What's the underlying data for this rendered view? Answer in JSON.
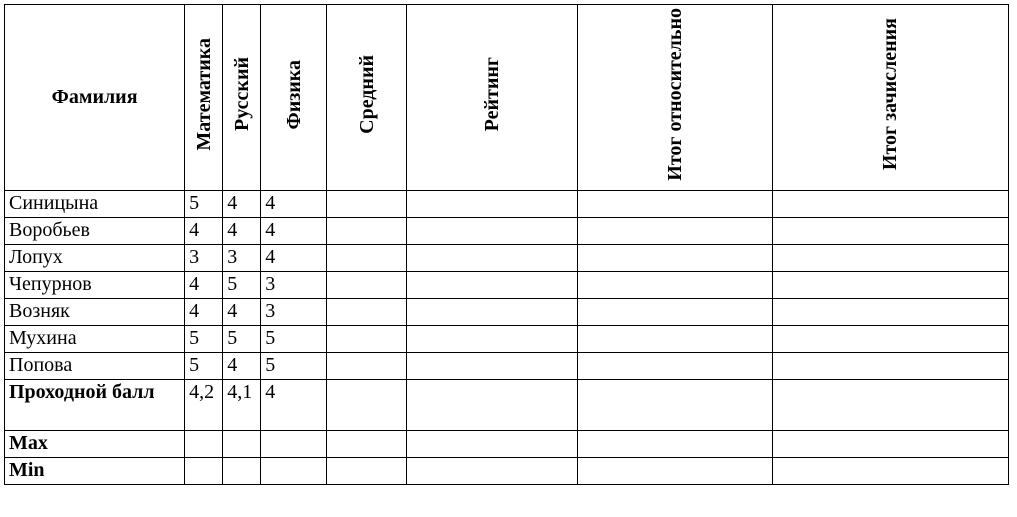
{
  "chart_data": {
    "type": "table",
    "title": "",
    "headers": [
      "Фамилия",
      "Математика",
      "Русский",
      "Физика",
      "Средний",
      "Рейтинг",
      "Итог относительно",
      "Итог зачисления"
    ],
    "rows": [
      {
        "surname": "Синицына",
        "math": "5",
        "rus": "4",
        "phys": "4",
        "avg": "",
        "rating": "",
        "rel": "",
        "enroll": "",
        "bold": false
      },
      {
        "surname": "Воробьев",
        "math": "4",
        "rus": "4",
        "phys": "4",
        "avg": "",
        "rating": "",
        "rel": "",
        "enroll": "",
        "bold": false
      },
      {
        "surname": "Лопух",
        "math": "3",
        "rus": "3",
        "phys": "4",
        "avg": "",
        "rating": "",
        "rel": "",
        "enroll": "",
        "bold": false
      },
      {
        "surname": "Чепурнов",
        "math": "4",
        "rus": "5",
        "phys": "3",
        "avg": "",
        "rating": "",
        "rel": "",
        "enroll": "",
        "bold": false
      },
      {
        "surname": "Возняк",
        "math": "4",
        "rus": "4",
        "phys": "3",
        "avg": "",
        "rating": "",
        "rel": "",
        "enroll": "",
        "bold": false
      },
      {
        "surname": "Мухина",
        "math": "5",
        "rus": "5",
        "phys": "5",
        "avg": "",
        "rating": "",
        "rel": "",
        "enroll": "",
        "bold": false
      },
      {
        "surname": "Попова",
        "math": "5",
        "rus": "4",
        "phys": "5",
        "avg": "",
        "rating": "",
        "rel": "",
        "enroll": "",
        "bold": false
      }
    ],
    "footer": [
      {
        "surname": "Проходной балл",
        "math": "4,2",
        "rus": "4,1",
        "phys": "4",
        "avg": "",
        "rating": "",
        "rel": "",
        "enroll": "",
        "bold": true,
        "tall": true
      },
      {
        "surname": "Max",
        "math": "",
        "rus": "",
        "phys": "",
        "avg": "",
        "rating": "",
        "rel": "",
        "enroll": "",
        "bold": true
      },
      {
        "surname": "Min",
        "math": "",
        "rus": "",
        "phys": "",
        "avg": "",
        "rating": "",
        "rel": "",
        "enroll": "",
        "bold": true
      }
    ]
  }
}
